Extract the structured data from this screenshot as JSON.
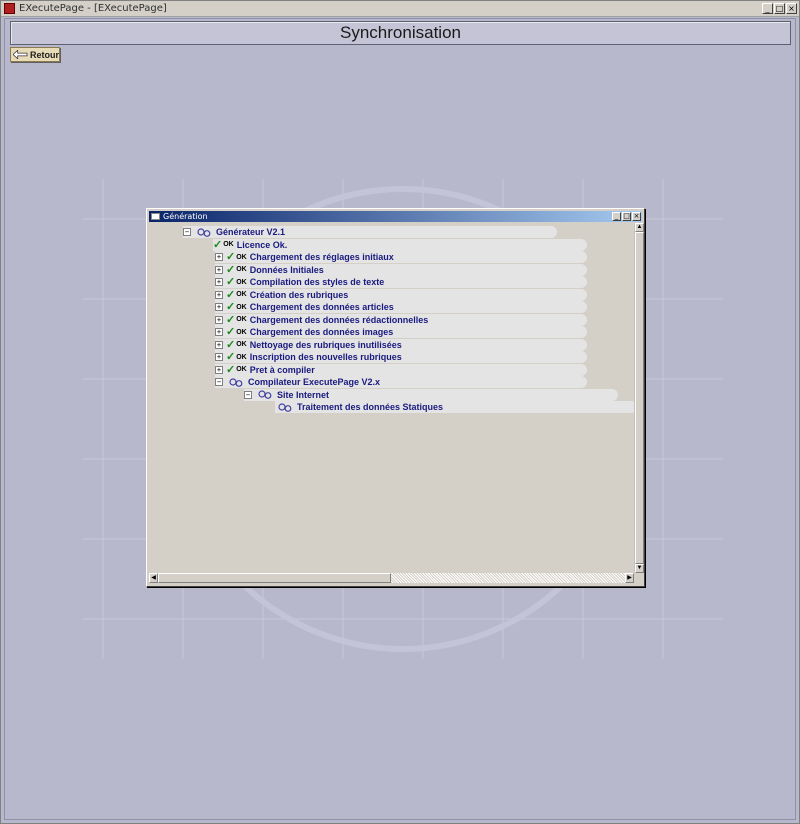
{
  "app": {
    "title": "EXecutePage - [EXecutePage]",
    "window_controls": [
      "_",
      "□",
      "×"
    ]
  },
  "header": {
    "title": "Synchronisation"
  },
  "toolbar": {
    "back_label": "Retour"
  },
  "generation_window": {
    "title": "Génération",
    "window_controls": [
      "_",
      "□",
      "×"
    ],
    "tree": {
      "root": "Générateur V2.1",
      "licence": "Licence Ok.",
      "ok_label": "OK",
      "steps": [
        "Chargement des réglages initiaux",
        "Données Initiales",
        "Compilation des styles de texte",
        "Création des rubriques",
        "Chargement des données articles",
        "Chargement des données rédactionnelles",
        "Chargement des données images",
        "Nettoyage des rubriques inutilisées",
        "Inscription des nouvelles rubriques",
        "Pret à compiler"
      ],
      "compiler": "Compilateur ExecutePage V2.x",
      "site": "Site Internet",
      "static_processing": "Traitement des données Statiques"
    }
  },
  "colors": {
    "background": "#b8b8cc",
    "tree_text": "#1a1a80",
    "check_green": "#1a8a1a",
    "titlebar_start": "#0a246a",
    "titlebar_end": "#a6caf0"
  }
}
